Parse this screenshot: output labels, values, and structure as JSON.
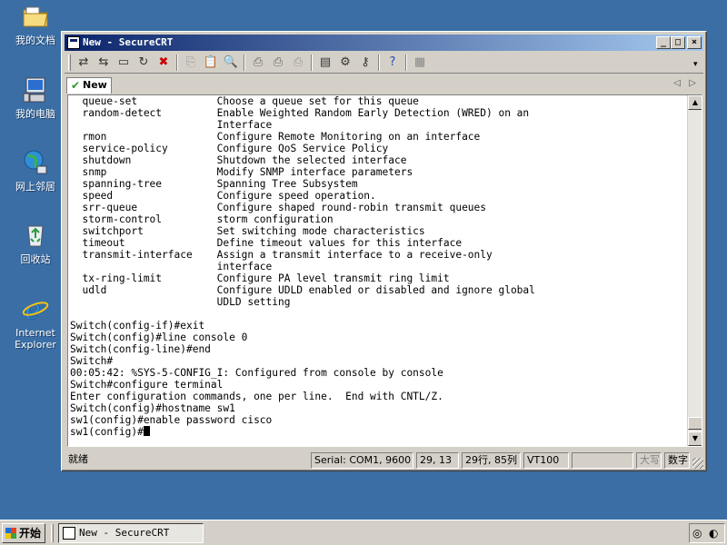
{
  "desktop": {
    "icons": [
      {
        "label": "我的文档"
      },
      {
        "label": "我的电脑"
      },
      {
        "label": "网上邻居"
      },
      {
        "label": "回收站"
      },
      {
        "label": "Internet Explorer"
      }
    ]
  },
  "window": {
    "title": "New - SecureCRT",
    "controls": {
      "minimize": "_",
      "maximize": "□",
      "close": "×"
    }
  },
  "tab": {
    "label": "New",
    "nav_prev": "◁",
    "nav_next": "▷"
  },
  "terminal": {
    "lines": [
      "  queue-set             Choose a queue set for this queue",
      "  random-detect         Enable Weighted Random Early Detection (WRED) on an",
      "                        Interface",
      "  rmon                  Configure Remote Monitoring on an interface",
      "  service-policy        Configure QoS Service Policy",
      "  shutdown              Shutdown the selected interface",
      "  snmp                  Modify SNMP interface parameters",
      "  spanning-tree         Spanning Tree Subsystem",
      "  speed                 Configure speed operation.",
      "  srr-queue             Configure shaped round-robin transmit queues",
      "  storm-control         storm configuration",
      "  switchport            Set switching mode characteristics",
      "  timeout               Define timeout values for this interface",
      "  transmit-interface    Assign a transmit interface to a receive-only",
      "                        interface",
      "  tx-ring-limit         Configure PA level transmit ring limit",
      "  udld                  Configure UDLD enabled or disabled and ignore global",
      "                        UDLD setting",
      "",
      "Switch(config-if)#exit",
      "Switch(config)#line console 0",
      "Switch(config-line)#end",
      "Switch#",
      "00:05:42: %SYS-5-CONFIG_I: Configured from console by console",
      "Switch#configure terminal",
      "Enter configuration commands, one per line.  End with CNTL/Z.",
      "Switch(config)#hostname sw1",
      "sw1(config)#enable password cisco"
    ],
    "prompt": "sw1(config)#"
  },
  "status": {
    "ready": "就绪",
    "connection": "Serial: COM1, 9600",
    "cursor_pos": "29, 13",
    "size": "29行, 85列",
    "emulation": "VT100",
    "caps": "大写",
    "num": "数字"
  },
  "taskbar": {
    "start_label": "开始",
    "task_label": "New - SecureCRT"
  },
  "colors": {
    "desktop": "#3a6ea5",
    "titlebar_start": "#0a246a",
    "titlebar_end": "#a6caf0",
    "chrome": "#d4d0c8"
  }
}
